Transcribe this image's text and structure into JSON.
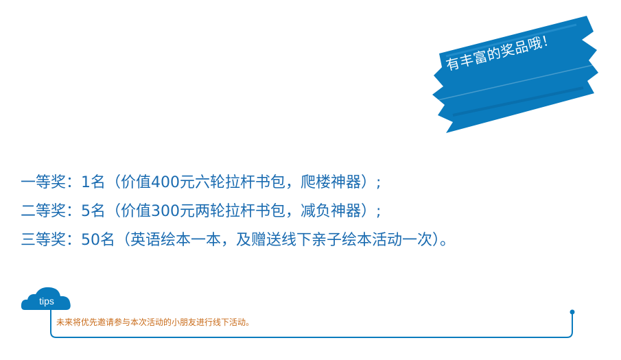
{
  "banner": {
    "text": "有丰富的奖品哦！",
    "color": "#0a7bbd"
  },
  "prizes": [
    "一等奖：1名（价值400元六轮拉杆书包，爬楼神器）;",
    "二等奖：5名（价值300元两轮拉杆书包，减负神器）;",
    "三等奖：50名（英语绘本一本，及赠送线下亲子绘本活动一次）。"
  ],
  "tips": {
    "label": "tips",
    "text": "未来将优先邀请参与本次活动的小朋友进行线下活动。",
    "cloud_color": "#0a7bbd",
    "text_color": "#c86a18"
  },
  "prize_color": "#1a6bb0"
}
